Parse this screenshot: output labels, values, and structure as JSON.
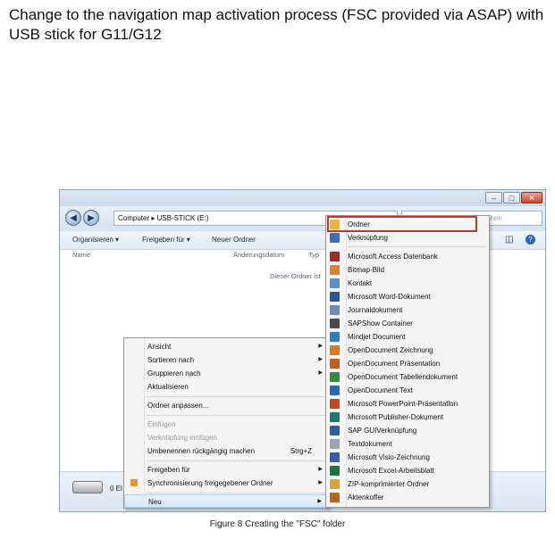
{
  "document": {
    "title": "Change to the navigation map activation process (FSC provided via ASAP) with USB stick for G11/G12",
    "caption": "Figure 8 Creating the \"FSC\" folder"
  },
  "explorer": {
    "address": "Computer ▸ USB-STICK (E:)",
    "search_placeholder": "USB-STICK (E:) durchsuchen",
    "toolbar": {
      "organize": "Organisieren ▾",
      "share": "Freigeben für ▾",
      "new_folder": "Neuer Ordner"
    },
    "columns": {
      "name": "Name",
      "modified": "Änderungsdatum",
      "type": "Typ"
    },
    "empty_message": "Dieser Ordner ist",
    "drive_items": "0 El"
  },
  "context_menu": {
    "items": [
      {
        "label": "Ansicht",
        "submenu": true
      },
      {
        "label": "Sortieren nach",
        "submenu": true
      },
      {
        "label": "Gruppieren nach",
        "submenu": true
      },
      {
        "label": "Aktualisieren"
      },
      {
        "label": "Ordner anpassen..."
      },
      {
        "label": "Einfügen",
        "disabled": true
      },
      {
        "label": "Verknüpfung einfügen",
        "disabled": true
      },
      {
        "label": "Umbenennen rückgängig machen",
        "shortcut": "Strg+Z"
      },
      {
        "label": "Freigeben für",
        "submenu": true
      },
      {
        "label": "Synchronisierung freigegebener Ordner",
        "submenu": true
      },
      {
        "label": "Neu",
        "submenu": true
      }
    ]
  },
  "new_submenu": {
    "items": [
      {
        "label": "Ordner",
        "icon": "folder-icon",
        "color": "#e9b73a"
      },
      {
        "label": "Verknüpfung",
        "icon": "shortcut-icon",
        "color": "#3d6fb5"
      },
      {
        "label": "Microsoft Access Datenbank",
        "icon": "access-icon",
        "color": "#9c2c2c"
      },
      {
        "label": "Bitmap-Bild",
        "icon": "bitmap-icon",
        "color": "#d9822b"
      },
      {
        "label": "Kontakt",
        "icon": "contact-icon",
        "color": "#5b8fc7"
      },
      {
        "label": "Microsoft Word-Dokument",
        "icon": "word-icon",
        "color": "#2b5797"
      },
      {
        "label": "Journaldokument",
        "icon": "journal-icon",
        "color": "#6a8fb3"
      },
      {
        "label": "SAPShow Container",
        "icon": "sapshow-icon",
        "color": "#4a4a4a"
      },
      {
        "label": "Mindjet Document",
        "icon": "mindjet-icon",
        "color": "#2e7fc0"
      },
      {
        "label": "OpenDocument Zeichnung",
        "icon": "odg-icon",
        "color": "#d97b1f"
      },
      {
        "label": "OpenDocument Präsentation",
        "icon": "odp-icon",
        "color": "#c85a1b"
      },
      {
        "label": "OpenDocument Tabellendokument",
        "icon": "ods-icon",
        "color": "#2f8f3a"
      },
      {
        "label": "OpenDocument Text",
        "icon": "odt-icon",
        "color": "#2c6bb3"
      },
      {
        "label": "Microsoft PowerPoint-Präsentation",
        "icon": "powerpoint-icon",
        "color": "#c4471b"
      },
      {
        "label": "Microsoft Publisher-Dokument",
        "icon": "publisher-icon",
        "color": "#1f7a6e"
      },
      {
        "label": "SAP GUIVerknüpfung",
        "icon": "sapgui-icon",
        "color": "#2a5fa8"
      },
      {
        "label": "Textdokument",
        "icon": "text-icon",
        "color": "#9aa4b2"
      },
      {
        "label": "Microsoft Visio-Zeichnung",
        "icon": "visio-icon",
        "color": "#3a5dae"
      },
      {
        "label": "Microsoft Excel-Arbeitsblatt",
        "icon": "excel-icon",
        "color": "#1e7145"
      },
      {
        "label": "ZIP-komprimierter Ordner",
        "icon": "zip-icon",
        "color": "#d8a62a"
      },
      {
        "label": "Aktenkoffer",
        "icon": "briefcase-icon",
        "color": "#b5651d"
      }
    ]
  }
}
